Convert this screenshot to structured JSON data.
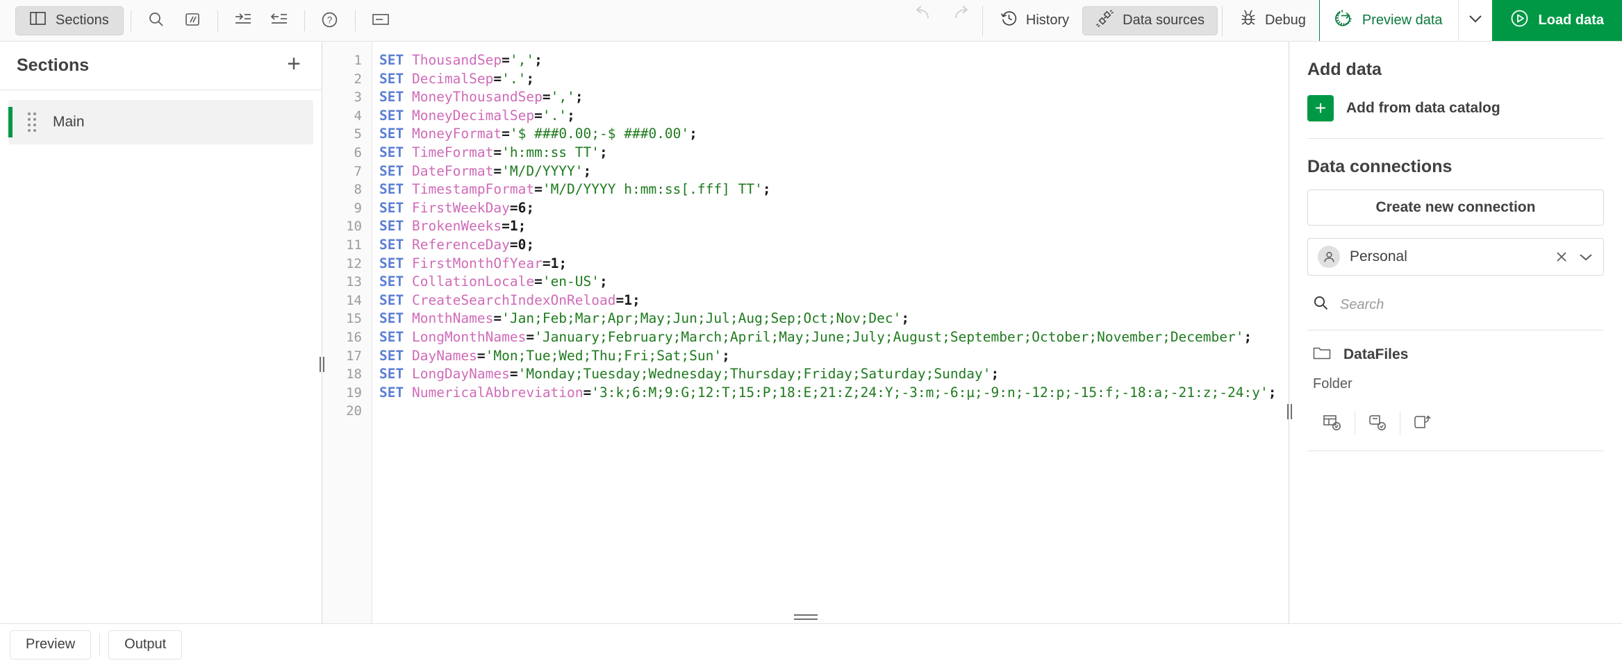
{
  "toolbar": {
    "sections_button": "Sections",
    "icons": {
      "panel": "panel-left-icon",
      "search": "search-icon",
      "comment": "comment-slashes-icon",
      "indent": "indent-icon",
      "outdent": "outdent-icon",
      "help": "help-circle-icon",
      "tooltip": "label-icon",
      "undo": "undo-arrow-icon",
      "redo": "redo-arrow-icon",
      "history": "history-clock-icon",
      "data_sources": "plug-connect-icon",
      "debug": "bug-icon",
      "preview": "gear-arrow-icon",
      "load": "play-circle-icon",
      "caret": "chevron-down-icon"
    },
    "history": "History",
    "data_sources": "Data sources",
    "debug": "Debug",
    "preview_data": "Preview data",
    "load_data": "Load data",
    "accent_green": "#009845",
    "preview_green": "#0b7a3e"
  },
  "sections": {
    "title": "Sections",
    "add_label": "+",
    "items": [
      {
        "label": "Main",
        "selected": true
      }
    ]
  },
  "editor": {
    "line_numbers": [
      "1",
      "2",
      "3",
      "4",
      "5",
      "6",
      "7",
      "8",
      "9",
      "10",
      "11",
      "12",
      "13",
      "14",
      "15",
      "16",
      "17",
      "18",
      "19",
      "20"
    ],
    "lines": [
      {
        "kw": "SET",
        "var": " ThousandSep",
        "op": "=",
        "str": "','",
        "tail": ";"
      },
      {
        "kw": "SET",
        "var": " DecimalSep",
        "op": "=",
        "str": "'.'",
        "tail": ";"
      },
      {
        "kw": "SET",
        "var": " MoneyThousandSep",
        "op": "=",
        "str": "','",
        "tail": ";"
      },
      {
        "kw": "SET",
        "var": " MoneyDecimalSep",
        "op": "=",
        "str": "'.'",
        "tail": ";"
      },
      {
        "kw": "SET",
        "var": " MoneyFormat",
        "op": "=",
        "str": "'$ ###0.00;-$ ###0.00'",
        "tail": ";"
      },
      {
        "kw": "SET",
        "var": " TimeFormat",
        "op": "=",
        "str": "'h:mm:ss TT'",
        "tail": ";"
      },
      {
        "kw": "SET",
        "var": " DateFormat",
        "op": "=",
        "str": "'M/D/YYYY'",
        "tail": ";"
      },
      {
        "kw": "SET",
        "var": " TimestampFormat",
        "op": "=",
        "str": "'M/D/YYYY h:mm:ss[.fff] TT'",
        "tail": ";"
      },
      {
        "kw": "SET",
        "var": " FirstWeekDay",
        "op": "=",
        "num": "6",
        "tail": ";"
      },
      {
        "kw": "SET",
        "var": " BrokenWeeks",
        "op": "=",
        "num": "1",
        "tail": ";"
      },
      {
        "kw": "SET",
        "var": " ReferenceDay",
        "op": "=",
        "num": "0",
        "tail": ";"
      },
      {
        "kw": "SET",
        "var": " FirstMonthOfYear",
        "op": "=",
        "num": "1",
        "tail": ";"
      },
      {
        "kw": "SET",
        "var": " CollationLocale",
        "op": "=",
        "str": "'en-US'",
        "tail": ";"
      },
      {
        "kw": "SET",
        "var": " CreateSearchIndexOnReload",
        "op": "=",
        "num": "1",
        "tail": ";"
      },
      {
        "kw": "SET",
        "var": " MonthNames",
        "op": "=",
        "str": "'Jan;Feb;Mar;Apr;May;Jun;Jul;Aug;Sep;Oct;Nov;Dec'",
        "tail": ";"
      },
      {
        "kw": "SET",
        "var": " LongMonthNames",
        "op": "=",
        "str": "'January;February;March;April;May;June;July;August;September;October;November;December'",
        "tail": ";"
      },
      {
        "kw": "SET",
        "var": " DayNames",
        "op": "=",
        "str": "'Mon;Tue;Wed;Thu;Fri;Sat;Sun'",
        "tail": ";"
      },
      {
        "kw": "SET",
        "var": " LongDayNames",
        "op": "=",
        "str": "'Monday;Tuesday;Wednesday;Thursday;Friday;Saturday;Sunday'",
        "tail": ";"
      },
      {
        "kw": "SET",
        "var": " NumericalAbbreviation",
        "op": "=",
        "str": "'3:k;6:M;9:G;12:T;15:P;18:E;21:Z;24:Y;-3:m;-6:µ;-9:n;-12:p;-15:f;-18:a;-21:z;-24:y'",
        "tail": ";"
      },
      {
        "kw": "",
        "var": "",
        "op": "",
        "str": "",
        "tail": ""
      }
    ]
  },
  "right_panel": {
    "add_data_title": "Add data",
    "add_from_catalog": "Add from data catalog",
    "data_connections_title": "Data connections",
    "create_new_connection": "Create new connection",
    "connection": {
      "name": "Personal",
      "clear_icon": "close-icon",
      "expand_icon": "chevron-down-icon"
    },
    "search_placeholder": "Search",
    "folder": {
      "name": "DataFiles",
      "type": "Folder",
      "icon": "folder-icon",
      "actions": [
        "select-data-icon",
        "load-script-icon",
        "edit-connection-icon"
      ]
    }
  },
  "footer": {
    "preview": "Preview",
    "output": "Output"
  }
}
